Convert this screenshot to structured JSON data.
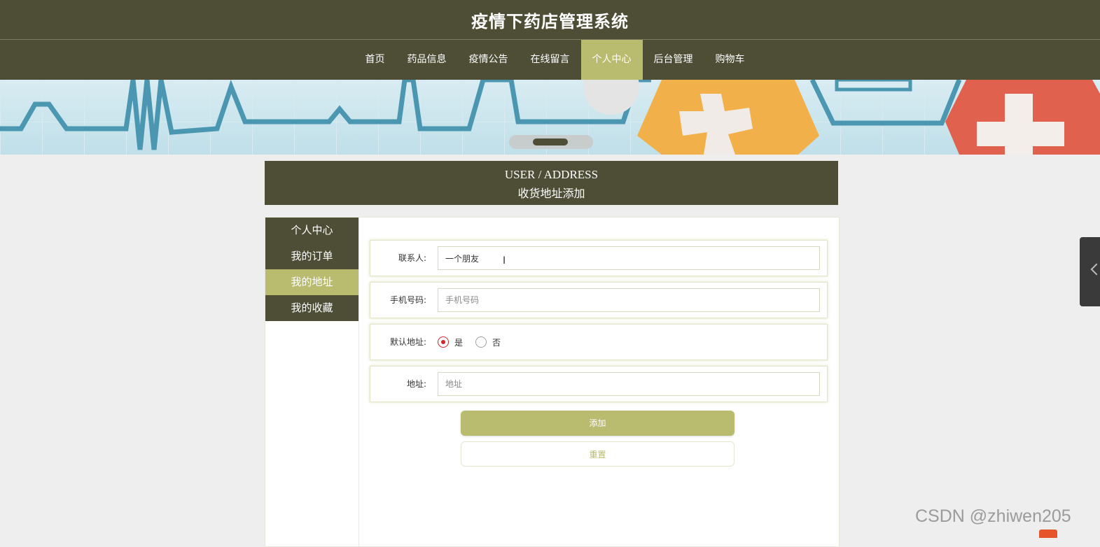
{
  "header": {
    "title": "疫情下药店管理系统"
  },
  "nav": {
    "items": [
      {
        "label": "首页",
        "active": false
      },
      {
        "label": "药品信息",
        "active": false
      },
      {
        "label": "疫情公告",
        "active": false
      },
      {
        "label": "在线留言",
        "active": false
      },
      {
        "label": "个人中心",
        "active": true
      },
      {
        "label": "后台管理",
        "active": false
      },
      {
        "label": "购物车",
        "active": false
      }
    ]
  },
  "section": {
    "title_en": "USER / ADDRESS",
    "title_cn": "收货地址添加"
  },
  "sidebar": {
    "items": [
      {
        "label": "个人中心",
        "active": false
      },
      {
        "label": "我的订单",
        "active": false
      },
      {
        "label": "我的地址",
        "active": true
      },
      {
        "label": "我的收藏",
        "active": false
      }
    ]
  },
  "form": {
    "contact": {
      "label": "联系人:",
      "value": "一个朋友"
    },
    "phone": {
      "label": "手机号码:",
      "placeholder": "手机号码",
      "value": ""
    },
    "default": {
      "label": "默认地址:",
      "yes": "是",
      "no": "否",
      "selected": "是"
    },
    "address": {
      "label": "地址:",
      "placeholder": "地址",
      "value": ""
    },
    "submit_label": "添加",
    "reset_label": "重置"
  },
  "watermark": "CSDN @zhiwen205",
  "colors": {
    "dark": "#4e4e37",
    "accent": "#b9bb6e",
    "radio": "#cc2a2a"
  },
  "icons": {
    "floating_tab": "chevron-left-icon",
    "text_cursor": "i-beam-cursor-icon"
  }
}
